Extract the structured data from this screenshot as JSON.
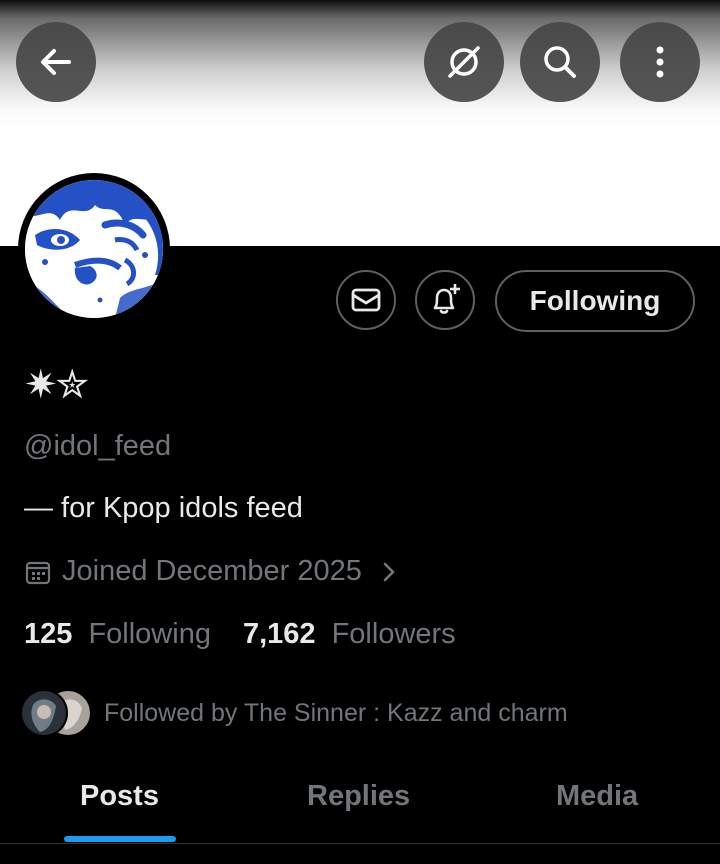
{
  "header": {
    "back_icon": "arrow-left-icon",
    "grok_icon": "grok-icon",
    "search_icon": "search-icon",
    "more_icon": "more-vertical-icon"
  },
  "profile": {
    "display_name": "✷✮",
    "handle": "@idol_feed",
    "bio": "— for Kpop idols feed",
    "joined": "Joined December 2025",
    "following_count": "125",
    "following_label": "Following",
    "followers_count": "7,162",
    "followers_label": "Followers",
    "followed_by": "Followed by The Sinner : Kazz and charm"
  },
  "actions": {
    "message_icon": "message-icon",
    "notify_icon": "bell-plus-icon",
    "following_button": "Following"
  },
  "tabs": [
    {
      "label": "Posts",
      "active": true
    },
    {
      "label": "Replies",
      "active": false
    },
    {
      "label": "Media",
      "active": false
    }
  ],
  "colors": {
    "background": "#000000",
    "accent": "#1d9bf0",
    "text_primary": "#e7e9ea",
    "text_secondary": "#71767b",
    "avatar_blue": "#2451c6"
  }
}
